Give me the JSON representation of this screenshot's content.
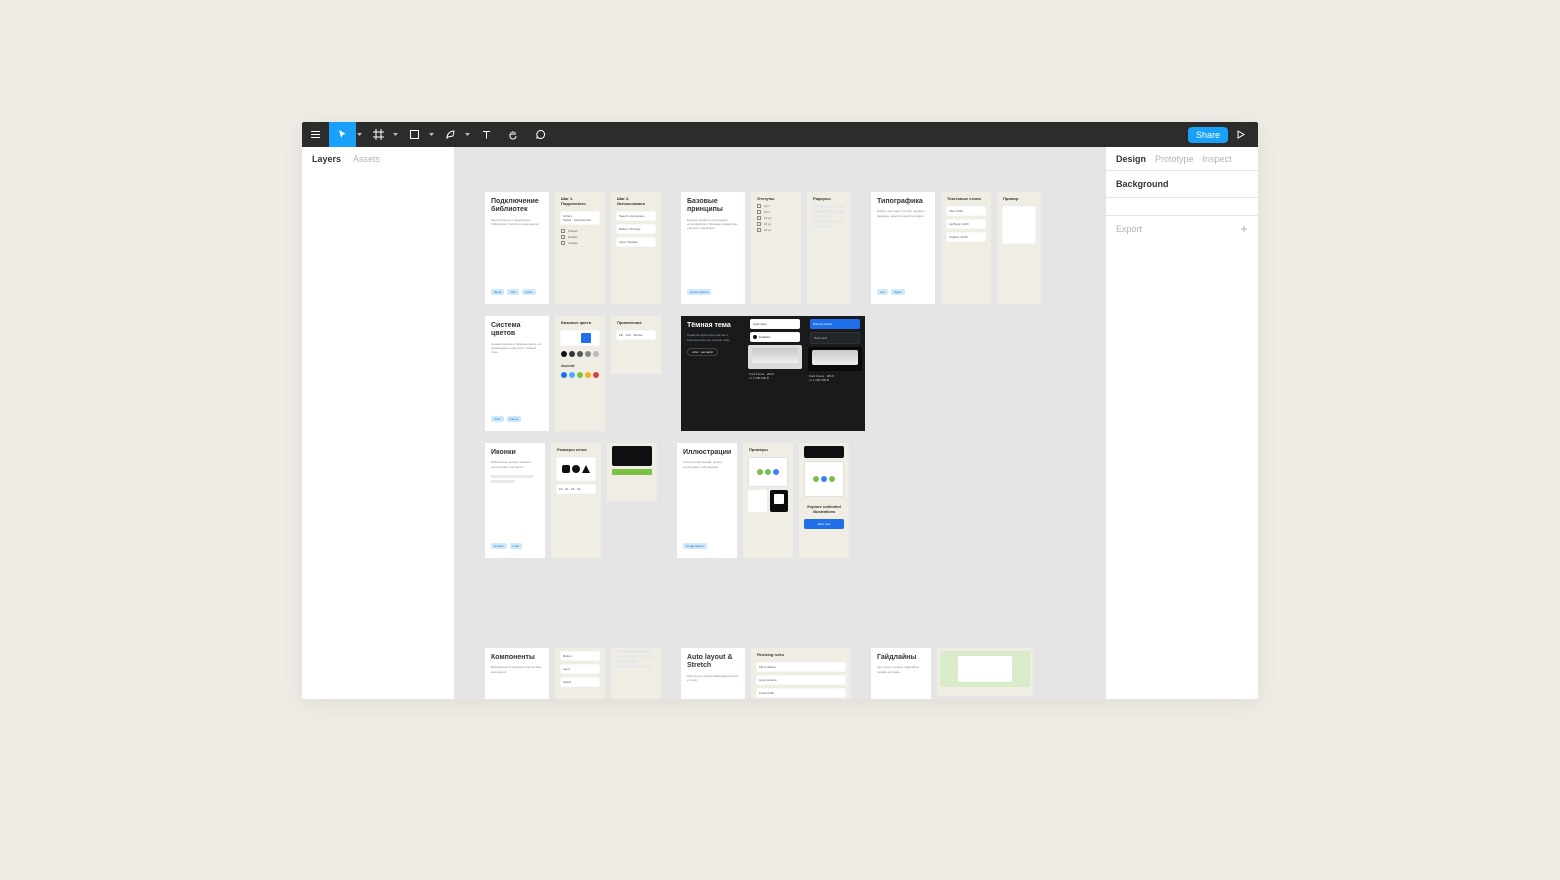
{
  "toolbar": {
    "share_label": "Share"
  },
  "left_panel": {
    "tab_layers": "Layers",
    "tab_assets": "Assets"
  },
  "right_panel": {
    "tab_design": "Design",
    "tab_prototype": "Prototype",
    "tab_inspect": "Inspect",
    "section_background": "Background",
    "section_export": "Export"
  },
  "canvas": {
    "row1": {
      "frame_libraries_title": "Подключение библиотек",
      "frame_basic_title": "Базовые принципы",
      "frame_typography_title": "Типографика",
      "tags": [
        "figma",
        "web",
        "styles"
      ]
    },
    "row2": {
      "frame_colors_title": "Система цветов",
      "frame_dark_title": "Тёмная тема"
    },
    "row3": {
      "frame_icons_title": "Иконки",
      "frame_illustrations_title": "Иллюстрации"
    },
    "row4": {
      "frame_components_title": "Компоненты",
      "frame_autolayout_title": "Auto layout & Stretch",
      "frame_guidelines_title": "Гайдлайны"
    }
  }
}
